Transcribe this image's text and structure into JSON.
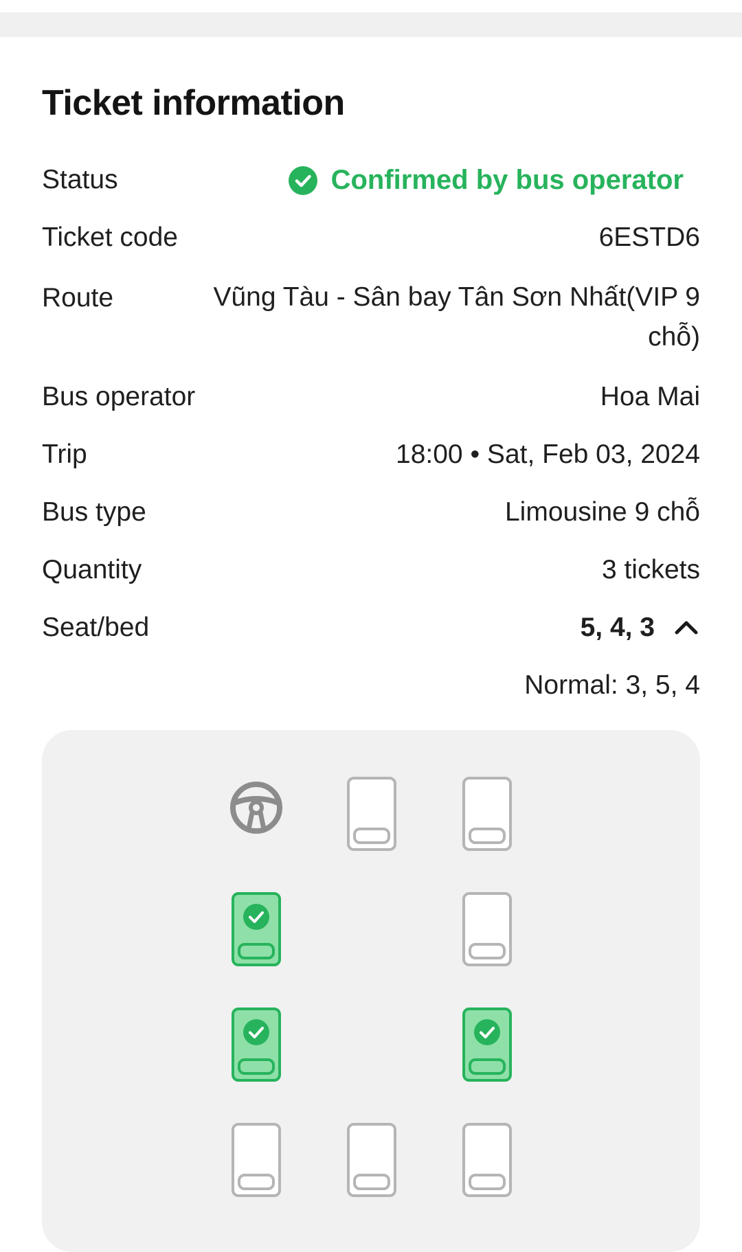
{
  "header": {
    "title": "Ticket information"
  },
  "rows": {
    "status": {
      "label": "Status",
      "value": "Confirmed by bus operator"
    },
    "ticket_code": {
      "label": "Ticket code",
      "value": "6ESTD6"
    },
    "route": {
      "label": "Route",
      "value": "Vũng Tàu - Sân bay Tân Sơn Nhất(VIP 9 chỗ)"
    },
    "operator": {
      "label": "Bus operator",
      "value": "Hoa Mai"
    },
    "trip": {
      "label": "Trip",
      "value": "18:00 • Sat, Feb 03, 2024"
    },
    "bus_type": {
      "label": "Bus type",
      "value": "Limousine 9 chỗ"
    },
    "quantity": {
      "label": "Quantity",
      "value": "3 tickets"
    },
    "seat": {
      "label": "Seat/bed",
      "value": "5, 4, 3"
    }
  },
  "seat_detail": "Normal: 3, 5, 4",
  "colors": {
    "accent_green": "#27b35c",
    "seat_booked_fill": "#8ee0a8",
    "seat_booked_border": "#27b35c",
    "seat_empty_border": "#b5b5b5",
    "map_background": "#f1f1f1"
  },
  "icons": {
    "status": "check-circle-icon",
    "seat_toggle": "chevron-up-icon",
    "driver": "steering-wheel-icon"
  },
  "seat_map": {
    "rows": [
      [
        "driver",
        "empty",
        "empty"
      ],
      [
        "booked",
        "none",
        "empty"
      ],
      [
        "booked",
        "none",
        "booked"
      ],
      [
        "empty",
        "empty",
        "empty"
      ]
    ]
  }
}
